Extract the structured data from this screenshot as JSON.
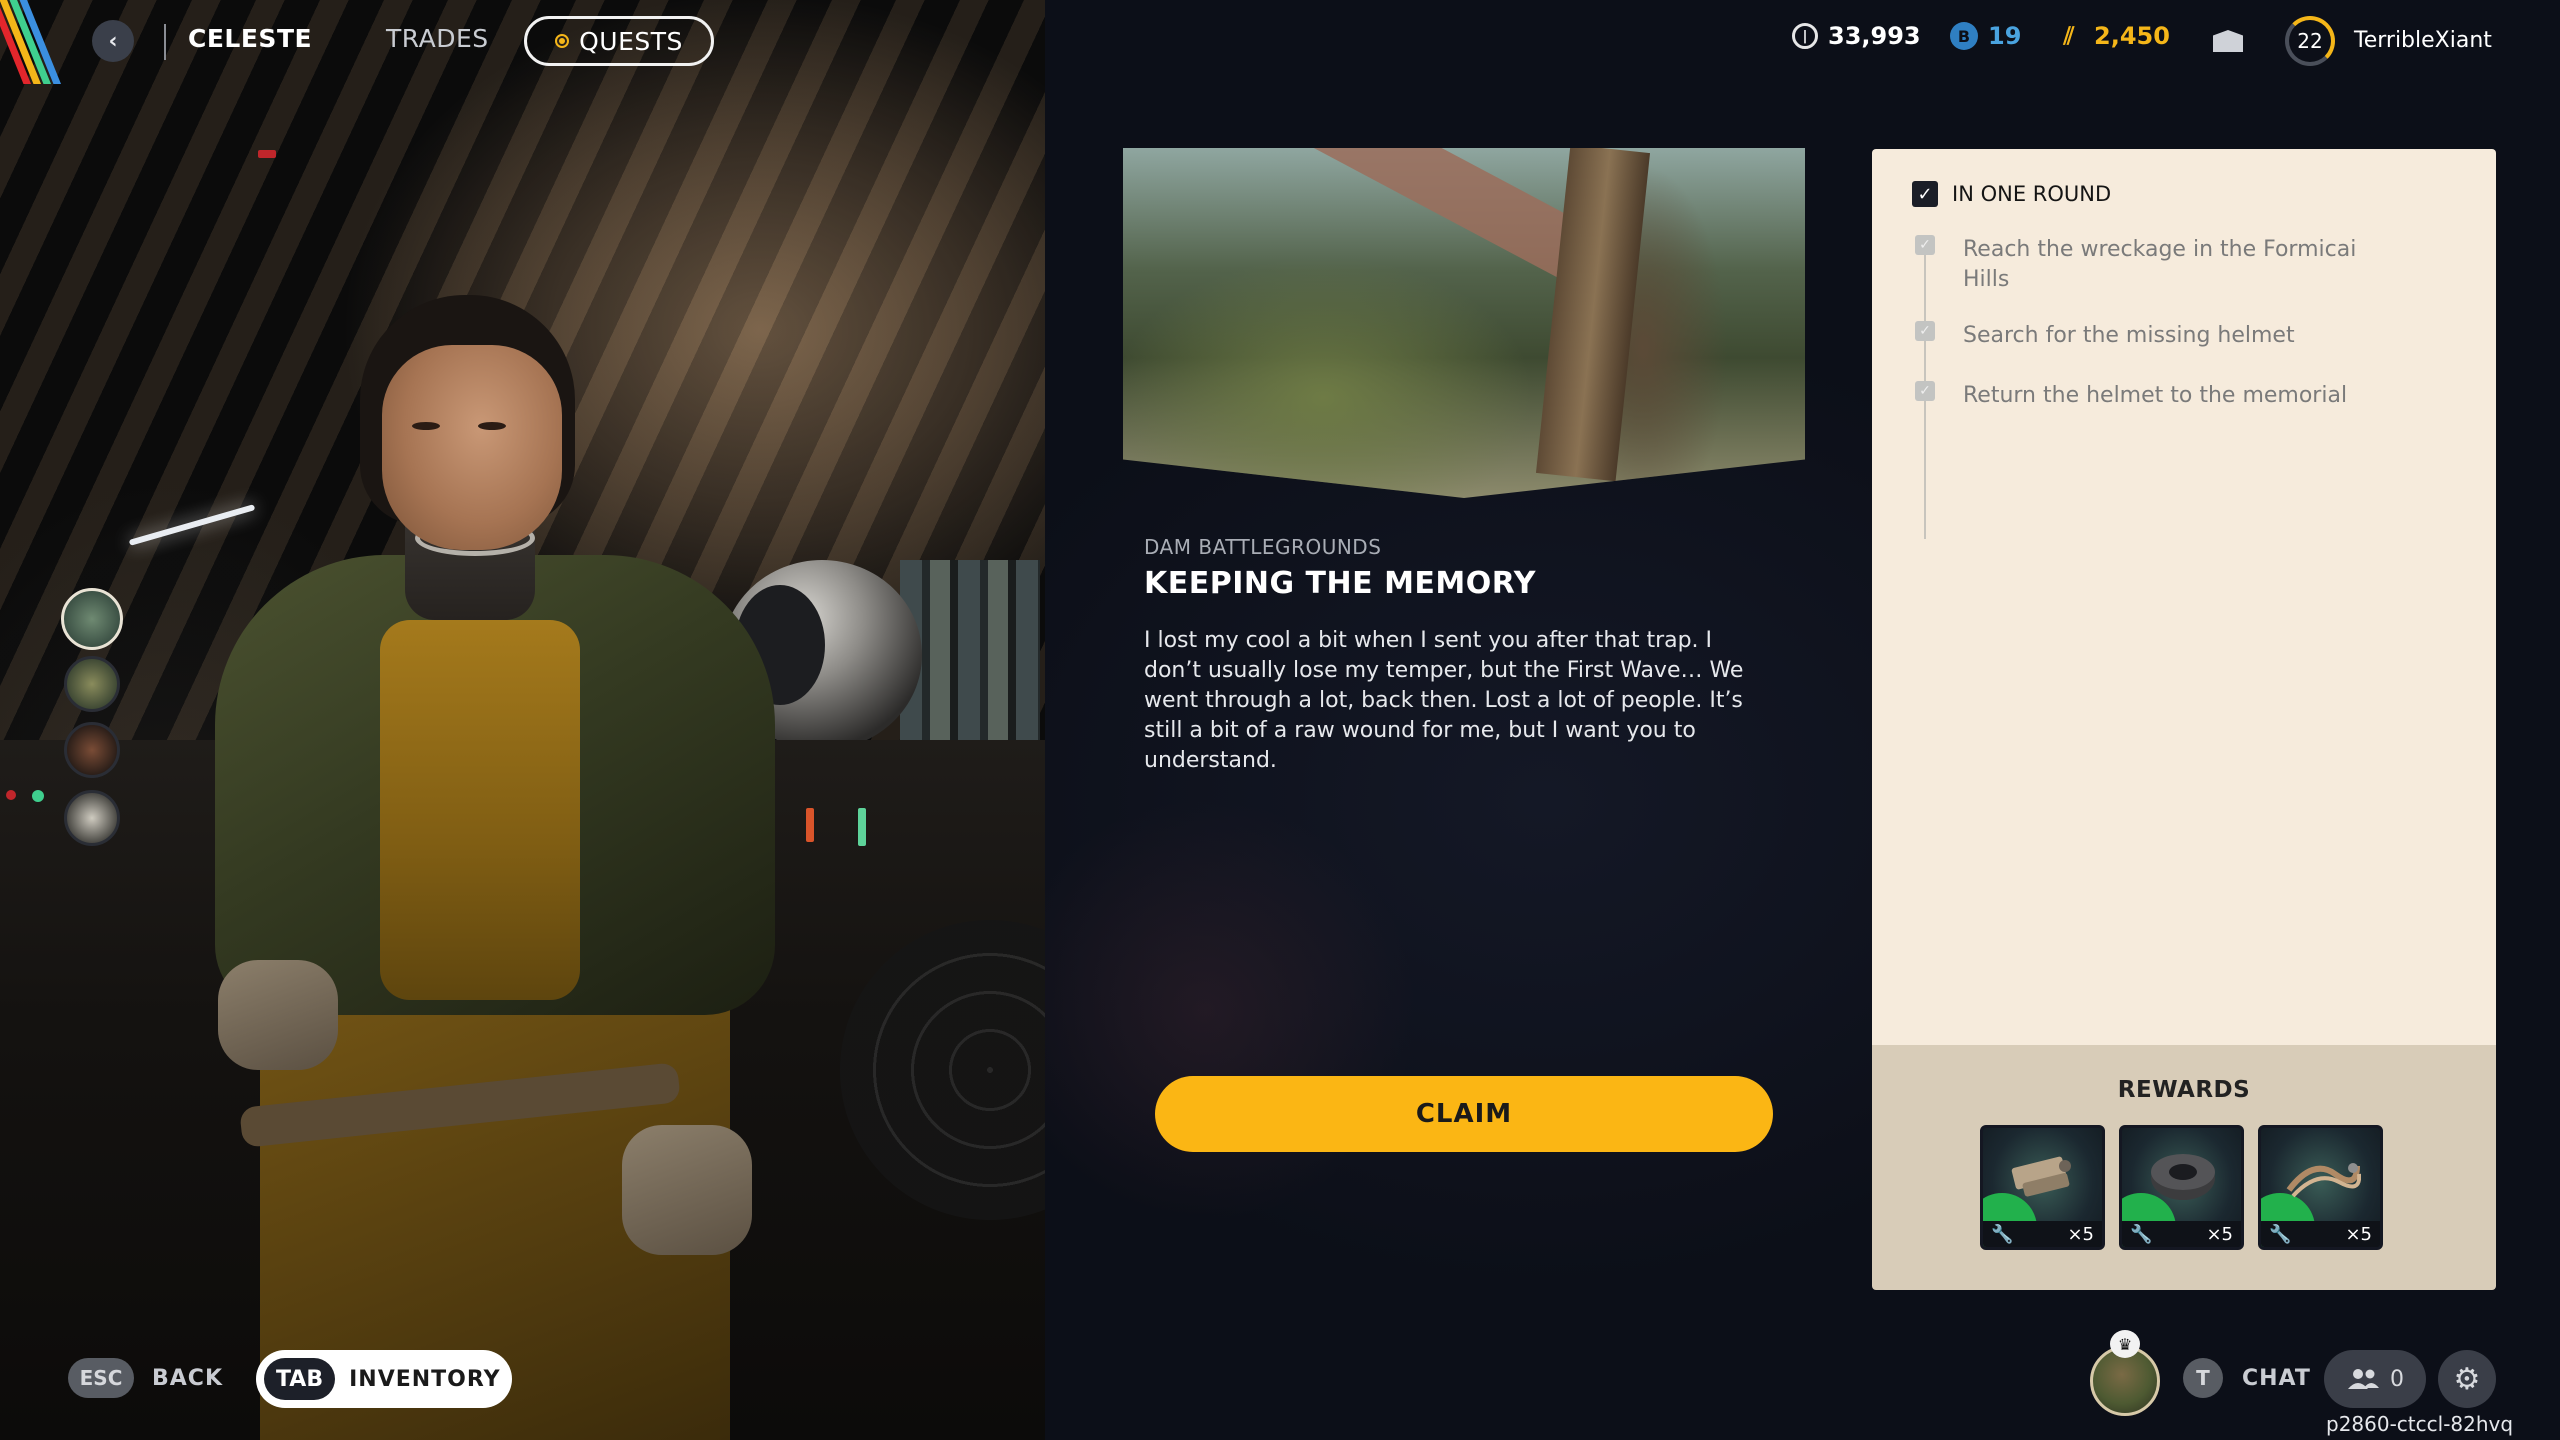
{
  "topbar": {
    "character_name": "CELESTE",
    "tabs": [
      {
        "label": "TRADES",
        "active": false
      },
      {
        "label": "QUESTS",
        "active": true
      }
    ],
    "currencies": [
      {
        "icon": "credits-coin-icon",
        "value": "33,993",
        "color": "#ffffff"
      },
      {
        "icon": "raider-token-icon",
        "value": "19",
        "color": "#4aa3df"
      },
      {
        "icon": "gold-bars-icon",
        "value": "2,450",
        "color": "#f5b619"
      }
    ],
    "player": {
      "level": "22",
      "username": "TerribleXiant"
    }
  },
  "variants": {
    "count": 4,
    "selected_index": 0
  },
  "quest": {
    "location": "DAM BATTLEGROUNDS",
    "title": "KEEPING THE MEMORY",
    "description": "I lost my cool a bit when I sent you after that trap. I don’t usually lose my temper, but the First Wave… We went through a lot, back then. Lost a lot of people. It’s still a bit of a raw wound for me, but I want you to understand.",
    "claim_label": "CLAIM"
  },
  "objectives": {
    "header": "IN ONE ROUND",
    "header_checked": true,
    "items": [
      {
        "text": "Reach the wreckage in the Formicai Hills",
        "checked": true
      },
      {
        "text": "Search for the missing helmet",
        "checked": true
      },
      {
        "text": "Return the helmet to the memorial",
        "checked": true
      }
    ]
  },
  "rewards": {
    "title": "REWARDS",
    "items": [
      {
        "icon": "mechanical-components-icon",
        "quantity": "×5"
      },
      {
        "icon": "duct-tape-icon",
        "quantity": "×5"
      },
      {
        "icon": "wires-icon",
        "quantity": "×5"
      }
    ]
  },
  "footer": {
    "esc_key": "ESC",
    "back_label": "BACK",
    "tab_key": "TAB",
    "inventory_label": "INVENTORY",
    "chat_key": "T",
    "chat_label": "CHAT",
    "friends_count": "0",
    "build_id": "p2860-ctccl-82hvq"
  },
  "colors": {
    "accent_yellow": "#fbb614",
    "panel_cream": "#f6ebdc",
    "rewards_tan": "#d8ccb8",
    "reward_green": "#22b14c"
  }
}
